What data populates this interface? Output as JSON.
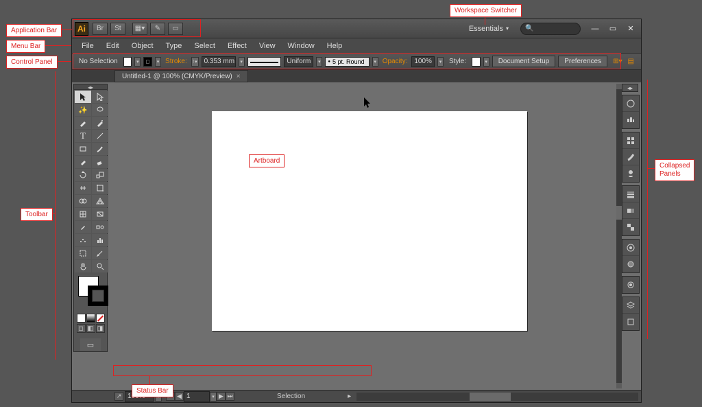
{
  "annotations": {
    "app_bar": "Application Bar",
    "menu_bar": "Menu Bar",
    "control_panel": "Control Panel",
    "toolbar": "Toolbar",
    "artboard": "Artboard",
    "status_bar": "Status Bar",
    "workspace_switcher": "Workspace Switcher",
    "collapsed_panels": "Collapsed\nPanels"
  },
  "app_bar": {
    "logo_text": "Ai"
  },
  "workspace_switcher": {
    "label": "Essentials"
  },
  "menu": [
    "File",
    "Edit",
    "Object",
    "Type",
    "Select",
    "Effect",
    "View",
    "Window",
    "Help"
  ],
  "control_panel": {
    "selection": "No Selection",
    "stroke_label": "Stroke:",
    "stroke_weight": "0.353 mm",
    "profile_label": "Uniform",
    "cap_label": "5 pt. Round",
    "opacity_label": "Opacity:",
    "opacity_value": "100%",
    "style_label": "Style:",
    "doc_setup": "Document Setup",
    "prefs": "Preferences",
    "fill_color": "#ffffff",
    "stroke_color": "#000000"
  },
  "doc_tab": {
    "title": "Untitled-1 @ 100% (CMYK/Preview)"
  },
  "status": {
    "zoom": "100%",
    "artboard_nav": "1",
    "info": "Selection"
  }
}
